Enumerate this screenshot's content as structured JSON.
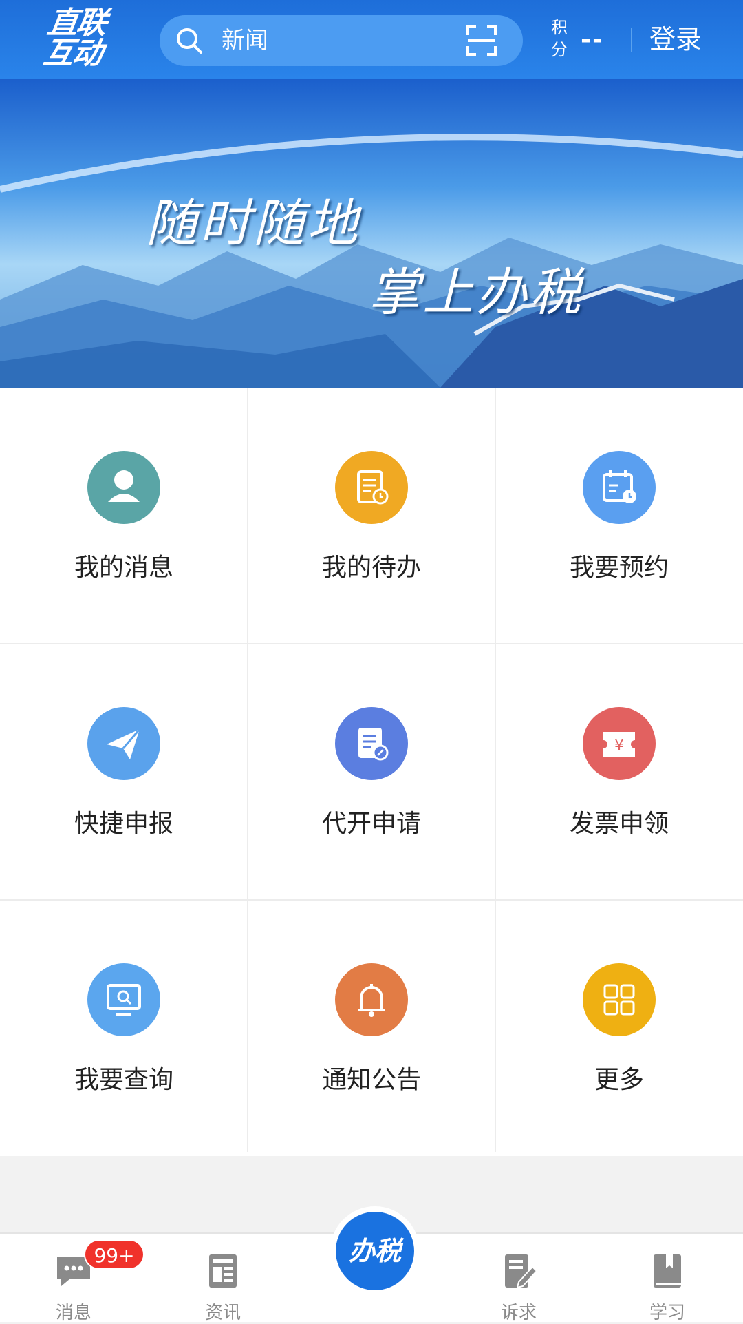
{
  "header": {
    "logo_line1": "直联",
    "logo_line2": "互动",
    "search_placeholder": "新闻",
    "points_label": "积分",
    "points_value": "--",
    "login_label": "登录"
  },
  "banner": {
    "line1": "随时随地",
    "line2": "掌上办税"
  },
  "grid": {
    "items": [
      {
        "label": "我的消息",
        "icon": "user-icon",
        "color": "#5aa5a6"
      },
      {
        "label": "我的待办",
        "icon": "todo-doc-icon",
        "color": "#f0a923"
      },
      {
        "label": "我要预约",
        "icon": "calendar-icon",
        "color": "#5a9ff0"
      },
      {
        "label": "快捷申报",
        "icon": "paper-plane-icon",
        "color": "#5aa2ec"
      },
      {
        "label": "代开申请",
        "icon": "document-edit-icon",
        "color": "#5b7ee0"
      },
      {
        "label": "发票申领",
        "icon": "invoice-ticket-icon",
        "color": "#e26160"
      },
      {
        "label": "我要查询",
        "icon": "monitor-search-icon",
        "color": "#5ba6ee"
      },
      {
        "label": "通知公告",
        "icon": "bell-icon",
        "color": "#e27c45"
      },
      {
        "label": "更多",
        "icon": "grid-more-icon",
        "color": "#efb012"
      }
    ]
  },
  "tabbar": {
    "tabs": [
      {
        "label": "消息",
        "icon": "chat-bubble-icon"
      },
      {
        "label": "资讯",
        "icon": "newspaper-icon"
      },
      {
        "label": "诉求",
        "icon": "edit-note-icon"
      },
      {
        "label": "学习",
        "icon": "book-icon"
      }
    ],
    "badge": "99+",
    "center_label": "办税"
  }
}
